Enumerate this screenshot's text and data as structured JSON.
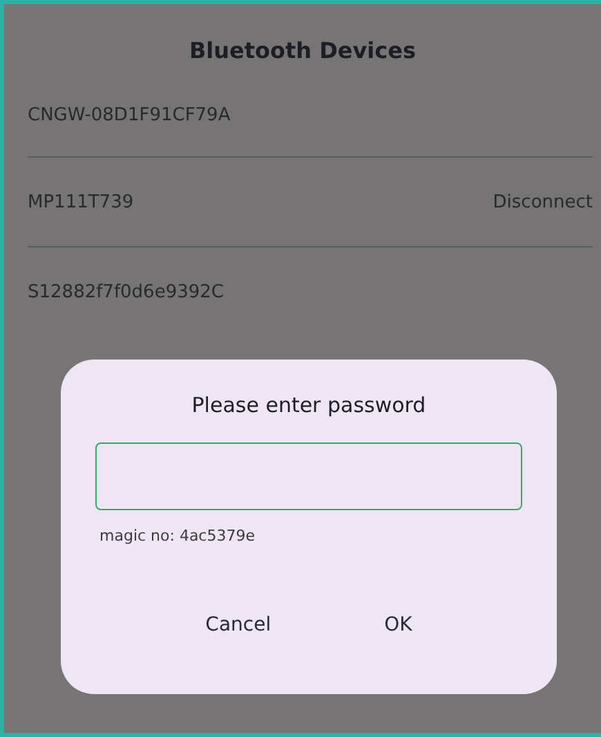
{
  "header": {
    "title": "Bluetooth Devices"
  },
  "devices": [
    {
      "name": "CNGW-08D1F91CF79A"
    },
    {
      "name": "MP111T739",
      "action": "Disconnect"
    },
    {
      "name": "S12882f7f0d6e9392C"
    }
  ],
  "dialog": {
    "title": "Please enter password",
    "field": {
      "focused": true
    },
    "note": "magic no: 4ac5379e",
    "buttons": [
      "Cancel",
      "OK"
    ]
  }
}
